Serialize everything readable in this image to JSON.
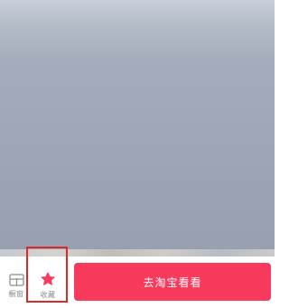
{
  "bottom_bar": {
    "store_label": "橱窗",
    "favorite_label": "收藏",
    "cta_label": "去淘宝看看"
  },
  "icons": {
    "store": "store-icon",
    "favorite": "star-icon"
  },
  "colors": {
    "accent": "#f83a5c",
    "highlight": "#e02828",
    "muted_text": "#8a8a8a"
  }
}
